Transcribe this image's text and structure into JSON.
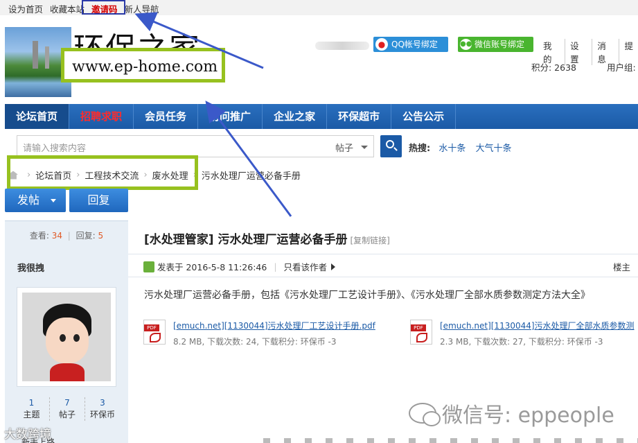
{
  "topbar": {
    "links": [
      "设为首页",
      "收藏本站"
    ],
    "invite": "邀请码",
    "newbie_nav": "新人导航"
  },
  "logo": {
    "title": "环保之家",
    "url": "www.ep-home.com"
  },
  "user_panel": {
    "qq_bind": "QQ帐号绑定",
    "wechat_bind": "微信账号绑定",
    "nav": [
      "我的",
      "设置",
      "消息",
      "提"
    ],
    "points_label": "积分: 2638",
    "usergroup_label": "用户组:"
  },
  "nav": {
    "items": [
      "论坛首页",
      "招聘求职",
      "会员任务",
      "访问推广",
      "企业之家",
      "环保超市",
      "公告公示"
    ]
  },
  "search": {
    "placeholder": "请输入搜索内容",
    "type": "帖子",
    "hot_label": "热搜:",
    "hot_terms": [
      "水十条",
      "大气十条"
    ]
  },
  "breadcrumb": [
    "论坛首页",
    "工程技术交流",
    "废水处理",
    "污水处理厂运营必备手册"
  ],
  "buttons": {
    "post": "发帖",
    "reply": "回复"
  },
  "thread": {
    "views_label": "查看:",
    "views": "34",
    "replies_label": "回复:",
    "replies": "5",
    "author": "我很拽",
    "user_stats": [
      {
        "num": "1",
        "label": "主题"
      },
      {
        "num": "7",
        "label": "帖子"
      },
      {
        "num": "3",
        "label": "环保币"
      }
    ],
    "rank": "新手上路",
    "title": "[水处理管家] 污水处理厂运营必备手册",
    "copy_link": "[复制链接]",
    "posted": "发表于 2016-5-8 11:26:46",
    "only_author": "只看该作者",
    "floor": "楼主",
    "body": "污水处理厂运营必备手册，包括《污水处理厂工艺设计手册》、《污水处理厂全部水质参数测定方法大全》"
  },
  "attachments": [
    {
      "name": "[emuch.net][1130044]污水处理厂工艺设计手册.pdf",
      "info": "8.2 MB, 下载次数: 24, 下载积分: 环保币 -3"
    },
    {
      "name": "[emuch.net][1130044]污水处理厂全部水质参数测",
      "info": "2.3 MB, 下载次数: 27, 下载积分: 环保币 -3"
    }
  ],
  "watermarks": {
    "wechat": "微信号: eppeople",
    "corner": "大数跨境"
  },
  "colors": {
    "nav_blue": "#1b5aa6",
    "highlight_green": "#97c11f",
    "arrow_blue": "#3b59c9",
    "invite_red": "#d40000"
  }
}
